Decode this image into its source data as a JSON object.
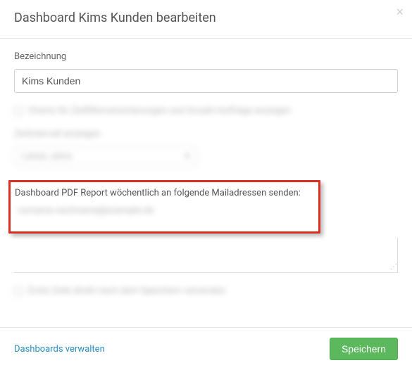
{
  "header": {
    "title": "Dashboard Kims Kunden bearbeiten"
  },
  "form": {
    "name_label": "Bezeichnung",
    "name_value": "Kims Kunden",
    "pdf_report_label": "Dashboard PDF Report wöchentlich an folgende Mailadressen senden:"
  },
  "footer": {
    "manage_link": "Dashboards verwalten",
    "save_label": "Speichern"
  }
}
